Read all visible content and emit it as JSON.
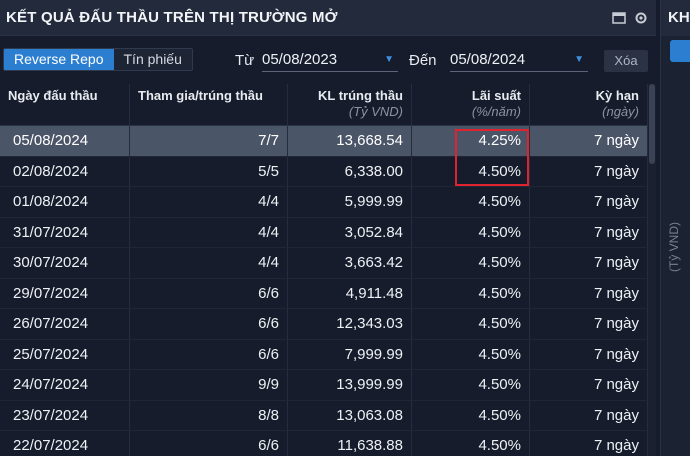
{
  "title": "KẾT QUẢ ĐẤU THẦU TRÊN THỊ TRƯỜNG MỞ",
  "side_panel": {
    "title": "KH",
    "unit": "(Tỷ VND)"
  },
  "tabs": [
    {
      "label": "Reverse Repo",
      "active": true
    },
    {
      "label": "Tín phiếu",
      "active": false
    }
  ],
  "filters": {
    "from_label": "Từ",
    "from_value": "05/08/2023",
    "to_label": "Đến",
    "to_value": "05/08/2024",
    "clear_label": "Xóa"
  },
  "columns": [
    {
      "label": "Ngày đấu thầu",
      "sub": ""
    },
    {
      "label": "Tham gia/trúng thầu",
      "sub": ""
    },
    {
      "label": "KL trúng thầu",
      "sub": "(Tỷ VND)"
    },
    {
      "label": "Lãi suất",
      "sub": "(%/năm)"
    },
    {
      "label": "Kỳ hạn",
      "sub": "(ngày)"
    }
  ],
  "rows": [
    {
      "date": "05/08/2024",
      "ratio": "7/7",
      "volume": "13,668.54",
      "rate": "4.25%",
      "term": "7 ngày"
    },
    {
      "date": "02/08/2024",
      "ratio": "5/5",
      "volume": "6,338.00",
      "rate": "4.50%",
      "term": "7 ngày"
    },
    {
      "date": "01/08/2024",
      "ratio": "4/4",
      "volume": "5,999.99",
      "rate": "4.50%",
      "term": "7 ngày"
    },
    {
      "date": "31/07/2024",
      "ratio": "4/4",
      "volume": "3,052.84",
      "rate": "4.50%",
      "term": "7 ngày"
    },
    {
      "date": "30/07/2024",
      "ratio": "4/4",
      "volume": "3,663.42",
      "rate": "4.50%",
      "term": "7 ngày"
    },
    {
      "date": "29/07/2024",
      "ratio": "6/6",
      "volume": "4,911.48",
      "rate": "4.50%",
      "term": "7 ngày"
    },
    {
      "date": "26/07/2024",
      "ratio": "6/6",
      "volume": "12,343.03",
      "rate": "4.50%",
      "term": "7 ngày"
    },
    {
      "date": "25/07/2024",
      "ratio": "6/6",
      "volume": "7,999.99",
      "rate": "4.50%",
      "term": "7 ngày"
    },
    {
      "date": "24/07/2024",
      "ratio": "9/9",
      "volume": "13,999.99",
      "rate": "4.50%",
      "term": "7 ngày"
    },
    {
      "date": "23/07/2024",
      "ratio": "8/8",
      "volume": "13,063.08",
      "rate": "4.50%",
      "term": "7 ngày"
    },
    {
      "date": "22/07/2024",
      "ratio": "6/6",
      "volume": "11,638.88",
      "rate": "4.50%",
      "term": "7 ngày"
    }
  ],
  "colors": {
    "accent": "#2c7fd0",
    "highlight_border": "#e0232f",
    "selected_row": "#4b5568"
  },
  "icons": [
    "window-icon",
    "settings-icon",
    "dropdown-caret-icon"
  ]
}
